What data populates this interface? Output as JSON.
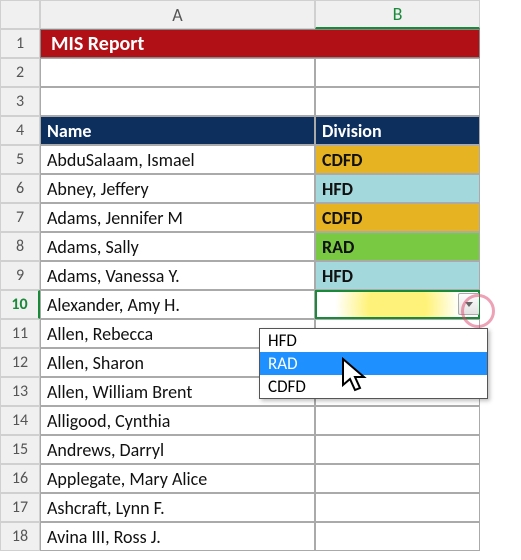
{
  "columns": {
    "A": "A",
    "B": "B"
  },
  "title": "MIS Report",
  "headers": {
    "name": "Name",
    "division": "Division"
  },
  "rows": [
    {
      "name": "AbduSalaam, Ismael",
      "division": "CDFD",
      "divclass": "div-cdfd"
    },
    {
      "name": "Abney, Jeffery",
      "division": "HFD",
      "divclass": "div-hfd"
    },
    {
      "name": "Adams, Jennifer M",
      "division": "CDFD",
      "divclass": "div-cdfd"
    },
    {
      "name": "Adams, Sally",
      "division": "RAD",
      "divclass": "div-rad"
    },
    {
      "name": "Adams, Vanessa Y.",
      "division": "HFD",
      "divclass": "div-hfd"
    },
    {
      "name": "Alexander, Amy H.",
      "division": "",
      "divclass": "activecell"
    },
    {
      "name": "Allen, Rebecca",
      "division": "",
      "divclass": ""
    },
    {
      "name": "Allen, Sharon",
      "division": "",
      "divclass": ""
    },
    {
      "name": "Allen, William Brent",
      "division": "",
      "divclass": ""
    },
    {
      "name": "Alligood, Cynthia",
      "division": "",
      "divclass": ""
    },
    {
      "name": "Andrews, Darryl",
      "division": "",
      "divclass": ""
    },
    {
      "name": "Applegate, Mary Alice",
      "division": "",
      "divclass": ""
    },
    {
      "name": "Ashcraft, Lynn F.",
      "division": "",
      "divclass": ""
    },
    {
      "name": "Avina III, Ross J.",
      "division": "",
      "divclass": ""
    }
  ],
  "dropdown": {
    "options": [
      "HFD",
      "RAD",
      "CDFD"
    ],
    "selected": "RAD"
  },
  "chart_data": {
    "type": "table",
    "title": "MIS Report",
    "columns": [
      "Name",
      "Division"
    ],
    "rows": [
      [
        "AbduSalaam, Ismael",
        "CDFD"
      ],
      [
        "Abney, Jeffery",
        "HFD"
      ],
      [
        "Adams, Jennifer M",
        "CDFD"
      ],
      [
        "Adams, Sally",
        "RAD"
      ],
      [
        "Adams, Vanessa Y.",
        "HFD"
      ],
      [
        "Alexander, Amy H.",
        ""
      ],
      [
        "Allen, Rebecca",
        ""
      ],
      [
        "Allen, Sharon",
        ""
      ],
      [
        "Allen, William Brent",
        ""
      ],
      [
        "Alligood, Cynthia",
        ""
      ],
      [
        "Andrews, Darryl",
        ""
      ],
      [
        "Applegate, Mary Alice",
        ""
      ],
      [
        "Ashcraft, Lynn F.",
        ""
      ],
      [
        "Avina III, Ross J.",
        ""
      ]
    ]
  }
}
